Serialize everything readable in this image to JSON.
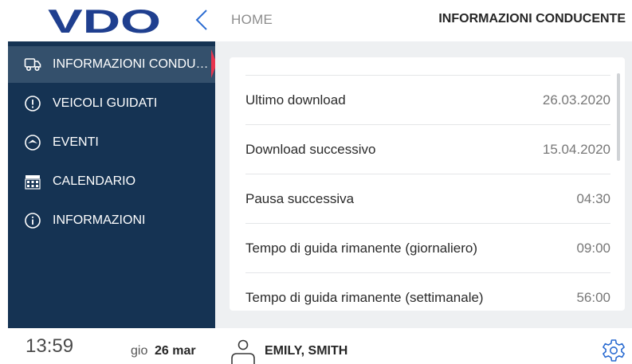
{
  "header": {
    "logo_text": "VDO",
    "back_icon": "chevron-left-icon",
    "breadcrumb": "HOME",
    "title": "INFORMAZIONI CONDUCENTE"
  },
  "sidebar": {
    "items": [
      {
        "label": "INFORMAZIONI CONDU…",
        "icon": "truck-icon",
        "active": true
      },
      {
        "label": "VEICOLI GUIDATI",
        "icon": "alert-circle-icon",
        "active": false
      },
      {
        "label": "EVENTI",
        "icon": "compass-icon",
        "active": false
      },
      {
        "label": "CALENDARIO",
        "icon": "calendar-icon",
        "active": false
      },
      {
        "label": "INFORMAZIONI",
        "icon": "info-icon",
        "active": false
      }
    ]
  },
  "main": {
    "rows": [
      {
        "label": "Ultimo download",
        "value": "26.03.2020"
      },
      {
        "label": "Download successivo",
        "value": "15.04.2020"
      },
      {
        "label": "Pausa successiva",
        "value": "04:30"
      },
      {
        "label": "Tempo di guida rimanente (giornaliero)",
        "value": "09:00"
      },
      {
        "label": "Tempo di guida rimanente (settimanale)",
        "value": "56:00"
      }
    ]
  },
  "footer": {
    "time": "13:59",
    "day": "gio",
    "date": "26 mar",
    "user_icon": "user-icon",
    "driver_name": "EMILY, SMITH",
    "settings_icon": "gear-icon"
  },
  "colors": {
    "sidebar_bg": "#153353",
    "sidebar_active": "#34506c",
    "accent_marker": "#e8344e",
    "logo": "#1f3f8f",
    "content_bg": "#eef0f2"
  }
}
